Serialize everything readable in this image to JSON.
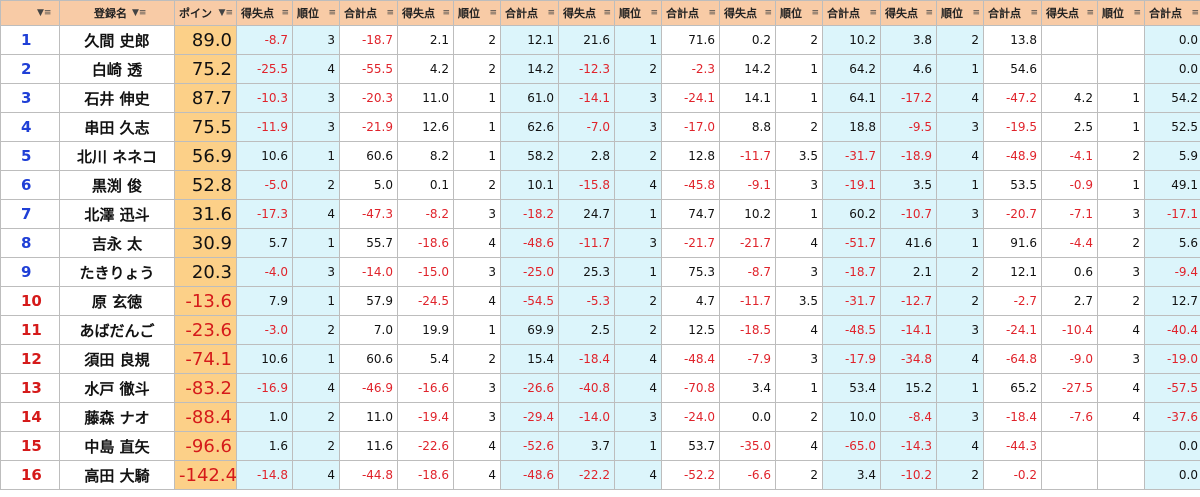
{
  "headers": {
    "name": "登録名",
    "points": "ポイン",
    "gain": "得失点",
    "order": "順位",
    "total": "合計点"
  },
  "blocks": 5,
  "rows": [
    {
      "rank": "1",
      "name": "久間 史郎",
      "points": "89.0",
      "cells": [
        [
          "-8.7",
          "3",
          "-18.7"
        ],
        [
          "2.1",
          "2",
          "12.1"
        ],
        [
          "21.6",
          "1",
          "71.6"
        ],
        [
          "0.2",
          "2",
          "10.2"
        ],
        [
          "3.8",
          "2",
          "13.8"
        ],
        [
          "",
          "",
          "0.0"
        ]
      ]
    },
    {
      "rank": "2",
      "name": "白崎 透",
      "points": "75.2",
      "cells": [
        [
          "-25.5",
          "4",
          "-55.5"
        ],
        [
          "4.2",
          "2",
          "14.2"
        ],
        [
          "-12.3",
          "2",
          "-2.3"
        ],
        [
          "14.2",
          "1",
          "64.2"
        ],
        [
          "4.6",
          "1",
          "54.6"
        ],
        [
          "",
          "",
          "0.0"
        ]
      ]
    },
    {
      "rank": "3",
      "name": "石井 伸史",
      "points": "87.7",
      "cells": [
        [
          "-10.3",
          "3",
          "-20.3"
        ],
        [
          "11.0",
          "1",
          "61.0"
        ],
        [
          "-14.1",
          "3",
          "-24.1"
        ],
        [
          "14.1",
          "1",
          "64.1"
        ],
        [
          "-17.2",
          "4",
          "-47.2"
        ],
        [
          "4.2",
          "1",
          "54.2"
        ]
      ]
    },
    {
      "rank": "4",
      "name": "串田 久志",
      "points": "75.5",
      "cells": [
        [
          "-11.9",
          "3",
          "-21.9"
        ],
        [
          "12.6",
          "1",
          "62.6"
        ],
        [
          "-7.0",
          "3",
          "-17.0"
        ],
        [
          "8.8",
          "2",
          "18.8"
        ],
        [
          "-9.5",
          "3",
          "-19.5"
        ],
        [
          "2.5",
          "1",
          "52.5"
        ]
      ]
    },
    {
      "rank": "5",
      "name": "北川 ネネコ",
      "points": "56.9",
      "cells": [
        [
          "10.6",
          "1",
          "60.6"
        ],
        [
          "8.2",
          "1",
          "58.2"
        ],
        [
          "2.8",
          "2",
          "12.8"
        ],
        [
          "-11.7",
          "3.5",
          "-31.7"
        ],
        [
          "-18.9",
          "4",
          "-48.9"
        ],
        [
          "-4.1",
          "2",
          "5.9"
        ]
      ]
    },
    {
      "rank": "6",
      "name": "黒渕 俊",
      "points": "52.8",
      "cells": [
        [
          "-5.0",
          "2",
          "5.0"
        ],
        [
          "0.1",
          "2",
          "10.1"
        ],
        [
          "-15.8",
          "4",
          "-45.8"
        ],
        [
          "-9.1",
          "3",
          "-19.1"
        ],
        [
          "3.5",
          "1",
          "53.5"
        ],
        [
          "-0.9",
          "1",
          "49.1"
        ]
      ]
    },
    {
      "rank": "7",
      "name": "北澤 迅斗",
      "points": "31.6",
      "cells": [
        [
          "-17.3",
          "4",
          "-47.3"
        ],
        [
          "-8.2",
          "3",
          "-18.2"
        ],
        [
          "24.7",
          "1",
          "74.7"
        ],
        [
          "10.2",
          "1",
          "60.2"
        ],
        [
          "-10.7",
          "3",
          "-20.7"
        ],
        [
          "-7.1",
          "3",
          "-17.1"
        ]
      ]
    },
    {
      "rank": "8",
      "name": "吉永 太",
      "points": "30.9",
      "cells": [
        [
          "5.7",
          "1",
          "55.7"
        ],
        [
          "-18.6",
          "4",
          "-48.6"
        ],
        [
          "-11.7",
          "3",
          "-21.7"
        ],
        [
          "-21.7",
          "4",
          "-51.7"
        ],
        [
          "41.6",
          "1",
          "91.6"
        ],
        [
          "-4.4",
          "2",
          "5.6"
        ]
      ]
    },
    {
      "rank": "9",
      "name": "たきりょう",
      "points": "20.3",
      "cells": [
        [
          "-4.0",
          "3",
          "-14.0"
        ],
        [
          "-15.0",
          "3",
          "-25.0"
        ],
        [
          "25.3",
          "1",
          "75.3"
        ],
        [
          "-8.7",
          "3",
          "-18.7"
        ],
        [
          "2.1",
          "2",
          "12.1"
        ],
        [
          "0.6",
          "3",
          "-9.4"
        ]
      ]
    },
    {
      "rank": "10",
      "name": "原 玄徳",
      "points": "-13.6",
      "cells": [
        [
          "7.9",
          "1",
          "57.9"
        ],
        [
          "-24.5",
          "4",
          "-54.5"
        ],
        [
          "-5.3",
          "2",
          "4.7"
        ],
        [
          "-11.7",
          "3.5",
          "-31.7"
        ],
        [
          "-12.7",
          "2",
          "-2.7"
        ],
        [
          "2.7",
          "2",
          "12.7"
        ]
      ]
    },
    {
      "rank": "11",
      "name": "あばだんご",
      "points": "-23.6",
      "cells": [
        [
          "-3.0",
          "2",
          "7.0"
        ],
        [
          "19.9",
          "1",
          "69.9"
        ],
        [
          "2.5",
          "2",
          "12.5"
        ],
        [
          "-18.5",
          "4",
          "-48.5"
        ],
        [
          "-14.1",
          "3",
          "-24.1"
        ],
        [
          "-10.4",
          "4",
          "-40.4"
        ]
      ]
    },
    {
      "rank": "12",
      "name": "須田 良規",
      "points": "-74.1",
      "cells": [
        [
          "10.6",
          "1",
          "60.6"
        ],
        [
          "5.4",
          "2",
          "15.4"
        ],
        [
          "-18.4",
          "4",
          "-48.4"
        ],
        [
          "-7.9",
          "3",
          "-17.9"
        ],
        [
          "-34.8",
          "4",
          "-64.8"
        ],
        [
          "-9.0",
          "3",
          "-19.0"
        ]
      ]
    },
    {
      "rank": "13",
      "name": "水戸 徹斗",
      "points": "-83.2",
      "cells": [
        [
          "-16.9",
          "4",
          "-46.9"
        ],
        [
          "-16.6",
          "3",
          "-26.6"
        ],
        [
          "-40.8",
          "4",
          "-70.8"
        ],
        [
          "3.4",
          "1",
          "53.4"
        ],
        [
          "15.2",
          "1",
          "65.2"
        ],
        [
          "-27.5",
          "4",
          "-57.5"
        ]
      ]
    },
    {
      "rank": "14",
      "name": "藤森 ナオ",
      "points": "-88.4",
      "cells": [
        [
          "1.0",
          "2",
          "11.0"
        ],
        [
          "-19.4",
          "3",
          "-29.4"
        ],
        [
          "-14.0",
          "3",
          "-24.0"
        ],
        [
          "0.0",
          "2",
          "10.0"
        ],
        [
          "-8.4",
          "3",
          "-18.4"
        ],
        [
          "-7.6",
          "4",
          "-37.6"
        ]
      ]
    },
    {
      "rank": "15",
      "name": "中島 直矢",
      "points": "-96.6",
      "cells": [
        [
          "1.6",
          "2",
          "11.6"
        ],
        [
          "-22.6",
          "4",
          "-52.6"
        ],
        [
          "3.7",
          "1",
          "53.7"
        ],
        [
          "-35.0",
          "4",
          "-65.0"
        ],
        [
          "-14.3",
          "4",
          "-44.3"
        ],
        [
          "",
          "",
          "0.0"
        ]
      ]
    },
    {
      "rank": "16",
      "name": "高田 大騎",
      "points": "-142.4",
      "cells": [
        [
          "-14.8",
          "4",
          "-44.8"
        ],
        [
          "-18.6",
          "4",
          "-48.6"
        ],
        [
          "-22.2",
          "4",
          "-52.2"
        ],
        [
          "-6.6",
          "2",
          "3.4"
        ],
        [
          "-10.2",
          "2",
          "-0.2"
        ],
        [
          "",
          "",
          "0.0"
        ]
      ]
    }
  ],
  "icons": {
    "filter": "filter-dropdown-icon"
  },
  "colors": {
    "header_bg": "#f8cba6",
    "points_bg": "#fcd088",
    "cyan_bg": "#dcf5fb",
    "rank_blue": "#1f3fd6",
    "neg_red": "#e0232b"
  }
}
